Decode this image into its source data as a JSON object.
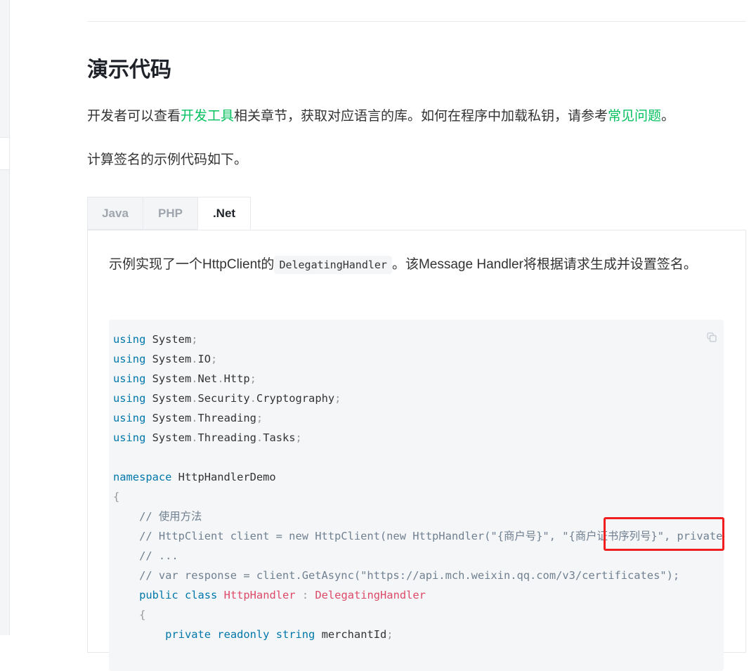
{
  "heading": "演示代码",
  "intro": {
    "before": "开发者可以查看",
    "link1": "开发工具",
    "middle": "相关章节，获取对应语言的库。如何在程序中加载私钥，请参考",
    "link2": "常见问题",
    "after": "。"
  },
  "sample_note": "计算签名的示例代码如下。",
  "tabs": [
    {
      "label": "Java"
    },
    {
      "label": "PHP"
    },
    {
      "label": ".Net",
      "active": true
    }
  ],
  "description": {
    "before": "示例实现了一个HttpClient的",
    "code": "DelegatingHandler",
    "after": "。该Message Handler将根据请求生成并设置签名。"
  },
  "code_lines": [
    [
      [
        "k",
        "using"
      ],
      [
        "t",
        " System"
      ],
      [
        "u",
        ";"
      ]
    ],
    [
      [
        "k",
        "using"
      ],
      [
        "t",
        " System"
      ],
      [
        "u",
        "."
      ],
      [
        "t",
        "IO"
      ],
      [
        "u",
        ";"
      ]
    ],
    [
      [
        "k",
        "using"
      ],
      [
        "t",
        " System"
      ],
      [
        "u",
        "."
      ],
      [
        "t",
        "Net"
      ],
      [
        "u",
        "."
      ],
      [
        "t",
        "Http"
      ],
      [
        "u",
        ";"
      ]
    ],
    [
      [
        "k",
        "using"
      ],
      [
        "t",
        " System"
      ],
      [
        "u",
        "."
      ],
      [
        "t",
        "Security"
      ],
      [
        "u",
        "."
      ],
      [
        "t",
        "Cryptography"
      ],
      [
        "u",
        ";"
      ]
    ],
    [
      [
        "k",
        "using"
      ],
      [
        "t",
        " System"
      ],
      [
        "u",
        "."
      ],
      [
        "t",
        "Threading"
      ],
      [
        "u",
        ";"
      ]
    ],
    [
      [
        "k",
        "using"
      ],
      [
        "t",
        " System"
      ],
      [
        "u",
        "."
      ],
      [
        "t",
        "Threading"
      ],
      [
        "u",
        "."
      ],
      [
        "t",
        "Tasks"
      ],
      [
        "u",
        ";"
      ]
    ],
    [],
    [
      [
        "k",
        "namespace"
      ],
      [
        "t",
        " HttpHandlerDemo"
      ]
    ],
    [
      [
        "u",
        "{"
      ]
    ],
    [
      [
        "c",
        "    // 使用方法"
      ]
    ],
    [
      [
        "c",
        "    // HttpClient client = new HttpClient(new HttpHandler(\"{商户号}\", \"{商户证书序列号}\", privateKey));"
      ]
    ],
    [
      [
        "c",
        "    // ..."
      ]
    ],
    [
      [
        "c",
        "    // var response = client.GetAsync(\"https://api.mch.weixin.qq.com/v3/certificates\");"
      ]
    ],
    [
      [
        "t",
        "    "
      ],
      [
        "k",
        "public"
      ],
      [
        "t",
        " "
      ],
      [
        "k",
        "class"
      ],
      [
        "t",
        " "
      ],
      [
        "n",
        "HttpHandler"
      ],
      [
        "t",
        " "
      ],
      [
        "u",
        ":"
      ],
      [
        "t",
        " "
      ],
      [
        "n",
        "DelegatingHandler"
      ]
    ],
    [
      [
        "t",
        "    "
      ],
      [
        "u",
        "{"
      ]
    ],
    [
      [
        "t",
        "        "
      ],
      [
        "k",
        "private"
      ],
      [
        "t",
        " "
      ],
      [
        "k",
        "readonly"
      ],
      [
        "t",
        " "
      ],
      [
        "k",
        "string"
      ],
      [
        "t",
        " merchantId"
      ],
      [
        "u",
        ";"
      ]
    ]
  ],
  "colors": {
    "accent": "#07c160",
    "highlight": "#f01e1e"
  }
}
